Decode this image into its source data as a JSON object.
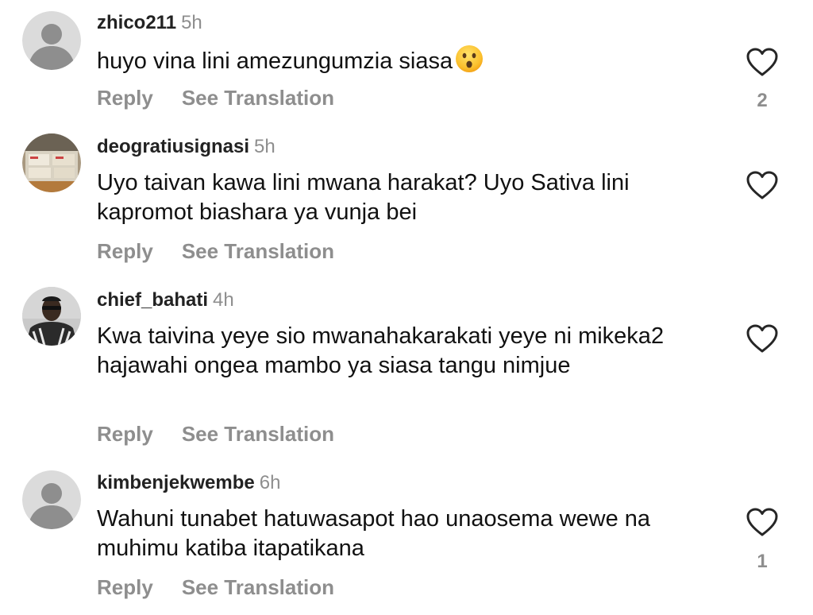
{
  "comments": [
    {
      "username": "zhico211",
      "time": "5h",
      "text": "huyo vina lini amezungumzia siasa",
      "emoji": "hushed-face",
      "reply_label": "Reply",
      "translate_label": "See Translation",
      "likes": "2",
      "avatar": "default"
    },
    {
      "username": "deogratiusignasi",
      "time": "5h",
      "text": "Uyo taivan kawa lini mwana harakat? Uyo Sativa lini kapromot biashara ya vunja bei",
      "reply_label": "Reply",
      "translate_label": "See Translation",
      "likes": "",
      "avatar": "photo-boxes"
    },
    {
      "username": "chief_bahati",
      "time": "4h",
      "text": "Kwa taivina yeye sio mwanahakarakati yeye ni mikeka2 hajawahi ongea mambo ya siasa tangu nimjue",
      "reply_label": "Reply",
      "translate_label": "See Translation",
      "likes": "",
      "avatar": "photo-person"
    },
    {
      "username": "kimbenjekwembe",
      "time": "6h",
      "text": "Wahuni tunabet hatuwasapot hao unaosema wewe na muhimu katiba itapatikana",
      "reply_label": "Reply",
      "translate_label": "See Translation",
      "likes": "1",
      "avatar": "default"
    }
  ],
  "colors": {
    "text": "#111111",
    "username": "#222222",
    "muted": "#8e8e8e",
    "avatar_bg": "#dbdbdb",
    "avatar_fg": "#8e8e8e"
  },
  "icons": {
    "like": "heart-outline-icon",
    "default_avatar": "person-silhouette-icon"
  }
}
